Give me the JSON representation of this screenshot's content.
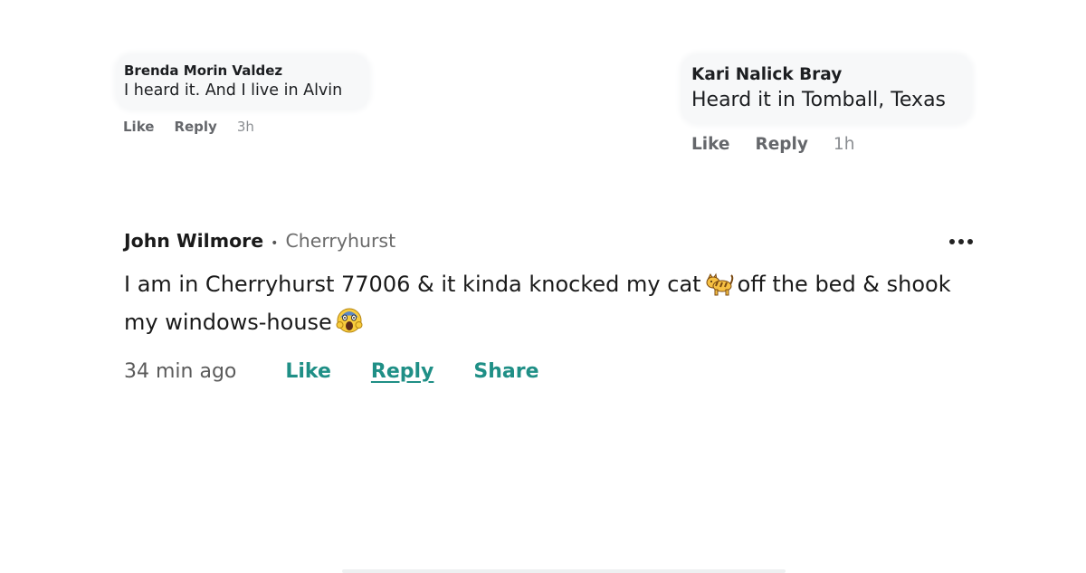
{
  "comments_top": {
    "brenda": {
      "author": "Brenda Morin Valdez",
      "text": "I heard it. And I live in Alvin",
      "like": "Like",
      "reply": "Reply",
      "time": "3h"
    },
    "kari": {
      "author": "Kari Nalick Bray",
      "text": "Heard it in Tomball, Texas",
      "like": "Like",
      "reply": "Reply",
      "time": "1h"
    }
  },
  "main_comment": {
    "author": "John Wilmore",
    "separator": "•",
    "neighborhood": "Cherryhurst",
    "text_part1": "I am in Cherryhurst 77006 & it kinda knocked my cat",
    "text_part2": "off the bed & shook my windows-house",
    "emoji_1": "cat-emoji",
    "emoji_2": "screaming-face-emoji",
    "time": "34 min ago",
    "like": "Like",
    "reply": "Reply",
    "share": "Share",
    "link_color": "#1f8f86"
  }
}
